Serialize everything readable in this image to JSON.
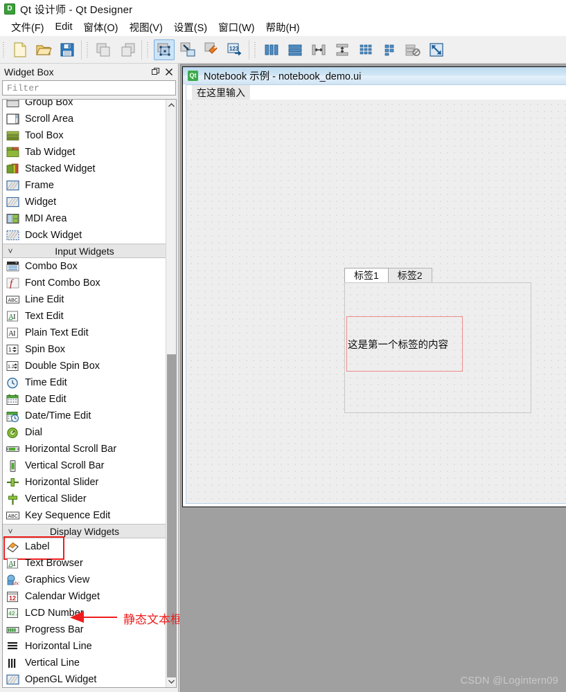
{
  "window": {
    "app_icon": "qt-designer-icon",
    "icon_letter": "D",
    "title": "Qt 设计师 - Qt Designer"
  },
  "menubar": {
    "items": [
      {
        "label": "文件(F)",
        "name": "menu-file"
      },
      {
        "label": "Edit",
        "name": "menu-edit"
      },
      {
        "label": "窗体(O)",
        "name": "menu-form"
      },
      {
        "label": "视图(V)",
        "name": "menu-view"
      },
      {
        "label": "设置(S)",
        "name": "menu-settings"
      },
      {
        "label": "窗口(W)",
        "name": "menu-window"
      },
      {
        "label": "帮助(H)",
        "name": "menu-help"
      }
    ]
  },
  "toolbar": {
    "groups": [
      {
        "buttons": [
          {
            "icon": "new-file-icon",
            "tooltip": "New"
          },
          {
            "icon": "open-folder-icon",
            "tooltip": "Open"
          },
          {
            "icon": "save-floppy-icon",
            "tooltip": "Save"
          }
        ]
      },
      {
        "buttons": [
          {
            "icon": "undo-icon",
            "tooltip": "Undo"
          },
          {
            "icon": "redo-icon",
            "tooltip": "Redo"
          }
        ]
      },
      {
        "buttons": [
          {
            "icon": "edit-widgets-icon",
            "tooltip": "Edit Widgets",
            "active": true
          },
          {
            "icon": "edit-signals-slots-icon",
            "tooltip": "Edit Signals/Slots"
          },
          {
            "icon": "edit-buddies-icon",
            "tooltip": "Edit Buddies"
          },
          {
            "icon": "edit-tab-order-icon",
            "tooltip": "Edit Tab Order"
          }
        ]
      },
      {
        "buttons": [
          {
            "icon": "layout-horizontally-icon",
            "tooltip": "Lay Out Horizontally"
          },
          {
            "icon": "layout-vertically-icon",
            "tooltip": "Lay Out Vertically"
          },
          {
            "icon": "layout-splitter-h-icon",
            "tooltip": "Lay Out in a Splitter Horizontally"
          },
          {
            "icon": "layout-splitter-v-icon",
            "tooltip": "Lay Out in a Splitter Vertically"
          },
          {
            "icon": "layout-form-icon",
            "tooltip": "Lay Out in a Form Layout"
          },
          {
            "icon": "layout-grid-icon",
            "tooltip": "Lay Out in a Grid"
          },
          {
            "icon": "break-layout-icon",
            "tooltip": "Break Layout"
          },
          {
            "icon": "adjust-size-icon",
            "tooltip": "Adjust Size"
          }
        ]
      }
    ]
  },
  "widget_box": {
    "title": "Widget Box",
    "float_button": "float-icon",
    "close_button": "close-icon",
    "filter": {
      "value": "",
      "placeholder": "Filter"
    },
    "scrollbar": {
      "up_arrow": "▲",
      "down_arrow": "▼"
    },
    "groups": [
      {
        "name": "containers-partial",
        "label": "",
        "collapsed": false,
        "items": [
          {
            "label": "Group Box",
            "icon": "group-box-icon"
          },
          {
            "label": "Scroll Area",
            "icon": "scroll-area-icon"
          },
          {
            "label": "Tool Box",
            "icon": "tool-box-icon"
          },
          {
            "label": "Tab Widget",
            "icon": "tab-widget-icon"
          },
          {
            "label": "Stacked Widget",
            "icon": "stacked-widget-icon"
          },
          {
            "label": "Frame",
            "icon": "frame-icon"
          },
          {
            "label": "Widget",
            "icon": "widget-icon"
          },
          {
            "label": "MDI Area",
            "icon": "mdi-area-icon"
          },
          {
            "label": "Dock Widget",
            "icon": "dock-widget-icon"
          }
        ]
      },
      {
        "name": "input-widgets",
        "label": "Input Widgets",
        "collapsed": false,
        "items": [
          {
            "label": "Combo Box",
            "icon": "combo-box-icon"
          },
          {
            "label": "Font Combo Box",
            "icon": "font-combo-box-icon"
          },
          {
            "label": "Line Edit",
            "icon": "line-edit-icon"
          },
          {
            "label": "Text Edit",
            "icon": "text-edit-icon"
          },
          {
            "label": "Plain Text Edit",
            "icon": "plain-text-edit-icon"
          },
          {
            "label": "Spin Box",
            "icon": "spin-box-icon"
          },
          {
            "label": "Double Spin Box",
            "icon": "double-spin-box-icon"
          },
          {
            "label": "Time Edit",
            "icon": "time-edit-icon"
          },
          {
            "label": "Date Edit",
            "icon": "date-edit-icon"
          },
          {
            "label": "Date/Time Edit",
            "icon": "date-time-edit-icon"
          },
          {
            "label": "Dial",
            "icon": "dial-icon"
          },
          {
            "label": "Horizontal Scroll Bar",
            "icon": "horizontal-scroll-bar-icon"
          },
          {
            "label": "Vertical Scroll Bar",
            "icon": "vertical-scroll-bar-icon"
          },
          {
            "label": "Horizontal Slider",
            "icon": "horizontal-slider-icon"
          },
          {
            "label": "Vertical Slider",
            "icon": "vertical-slider-icon"
          },
          {
            "label": "Key Sequence Edit",
            "icon": "key-sequence-edit-icon"
          }
        ]
      },
      {
        "name": "display-widgets",
        "label": "Display Widgets",
        "collapsed": false,
        "items": [
          {
            "label": "Label",
            "icon": "label-icon",
            "highlighted": true
          },
          {
            "label": "Text Browser",
            "icon": "text-browser-icon"
          },
          {
            "label": "Graphics View",
            "icon": "graphics-view-icon"
          },
          {
            "label": "Calendar Widget",
            "icon": "calendar-widget-icon"
          },
          {
            "label": "LCD Number",
            "icon": "lcd-number-icon"
          },
          {
            "label": "Progress Bar",
            "icon": "progress-bar-icon"
          },
          {
            "label": "Horizontal Line",
            "icon": "horizontal-line-icon"
          },
          {
            "label": "Vertical Line",
            "icon": "vertical-line-icon"
          },
          {
            "label": "OpenGL Widget",
            "icon": "opengl-widget-icon"
          }
        ]
      }
    ]
  },
  "form_window": {
    "icon": "qt-icon",
    "icon_letter": "Qt",
    "title": "Notebook 示例 - notebook_demo.ui",
    "menubar_placeholder": "在这里输入",
    "tab_widget": {
      "tabs": [
        {
          "label": "标签1",
          "selected": true
        },
        {
          "label": "标签2",
          "selected": false
        }
      ],
      "selected_label_text": "这是第一个标签的内容"
    }
  },
  "annotation": {
    "arrow": "left-arrow-annotation",
    "text": "静态文本框",
    "color": "#ee1c1c"
  },
  "watermark": {
    "text": "CSDN @Logintern09"
  },
  "colors": {
    "accent": "#cce4f7",
    "annotation_red": "#ee1c1c",
    "selection_border": "#f08a8a",
    "mdi_background": "#a0a0a0",
    "dock_background": "#f0f0f0"
  }
}
